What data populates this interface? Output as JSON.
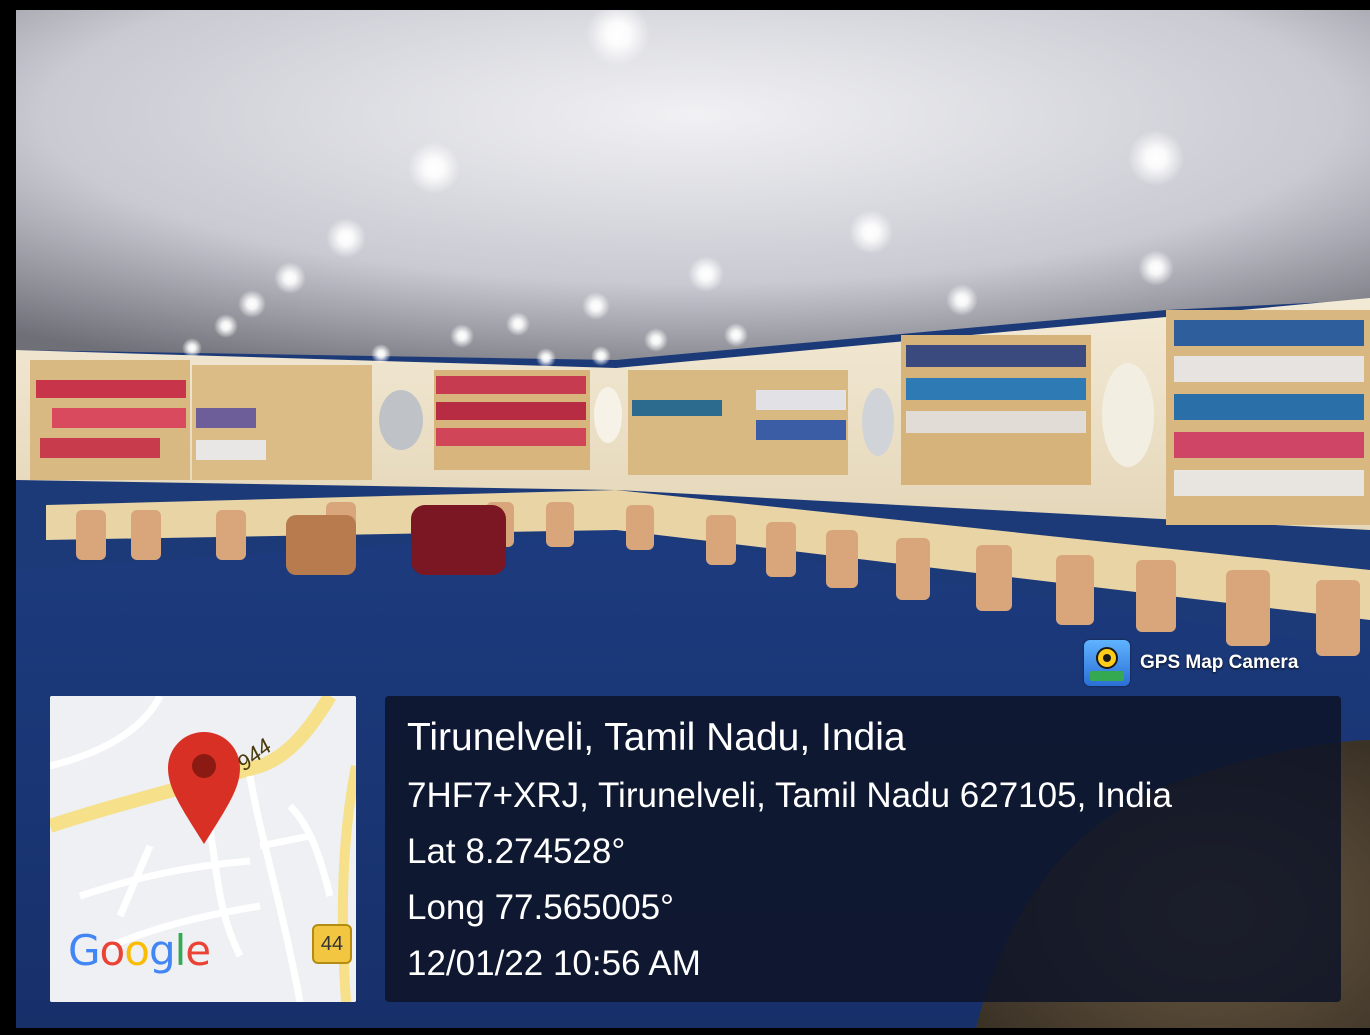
{
  "app": {
    "badge_label": "GPS Map Camera",
    "badge_icon": "gps-map-camera-icon"
  },
  "map": {
    "logo_letters": [
      {
        "char": "G",
        "color": "#4285F4"
      },
      {
        "char": "o",
        "color": "#EA4335"
      },
      {
        "char": "o",
        "color": "#FBBC05"
      },
      {
        "char": "g",
        "color": "#4285F4"
      },
      {
        "char": "l",
        "color": "#34A853"
      },
      {
        "char": "e",
        "color": "#EA4335"
      }
    ],
    "route_number": "44",
    "road_label": "944",
    "marker_color": "#D93025",
    "road_color": "#F6E08A"
  },
  "location": {
    "place": "Tirunelveli, Tamil Nadu, India",
    "address": "7HF7+XRJ, Tirunelveli, Tamil Nadu 627105, India",
    "lat": "Lat 8.274528°",
    "long": "Long 77.565005°",
    "timestamp": "12/01/22 10:56 AM"
  },
  "colors": {
    "carpet": "#1f3f84",
    "ceiling": "#dcdde3",
    "panel": "#0e1426"
  }
}
